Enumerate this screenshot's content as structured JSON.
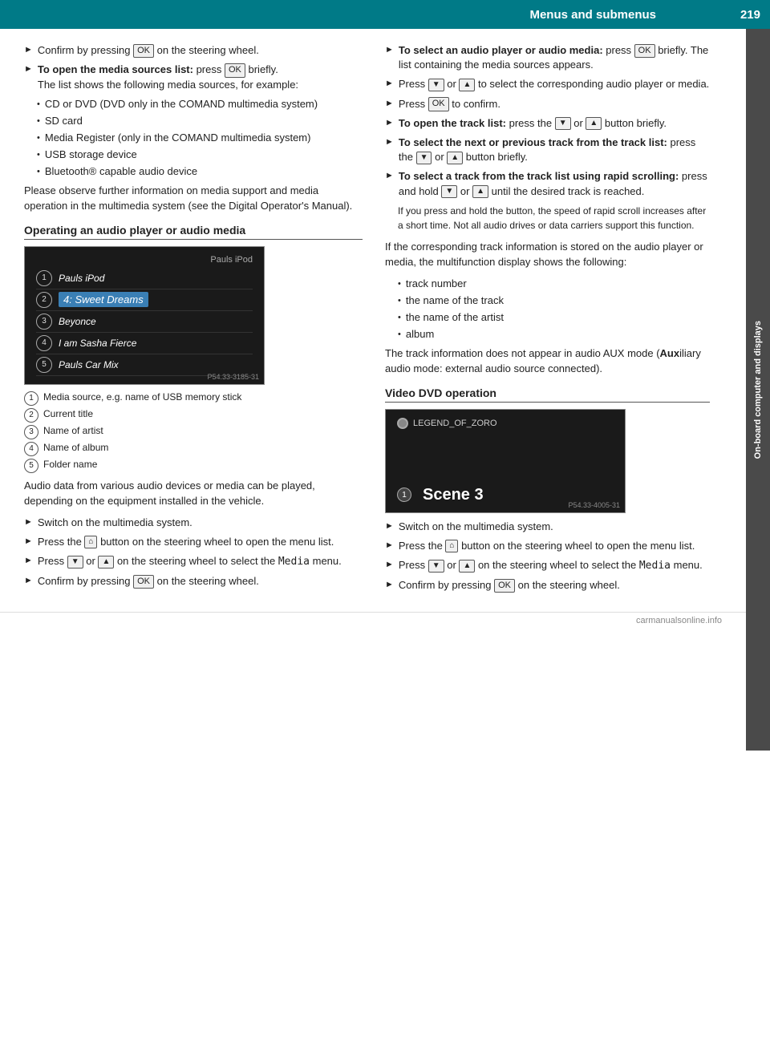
{
  "header": {
    "title": "Menus and submenus",
    "page_number": "219"
  },
  "sidebar_label": "On-board computer and displays",
  "left_col": {
    "bullet1": {
      "text_before": "Confirm by pressing ",
      "btn": "OK",
      "text_after": " on the steering wheel."
    },
    "bullet2": {
      "bold_part": "To open the media sources list:",
      "text_part": " press ",
      "btn": "OK",
      "text2": " briefly.",
      "subtext": "The list shows the following media sources, for example:"
    },
    "sub_bullets": [
      "CD or DVD (DVD only in the COMAND multimedia system)",
      "SD card",
      "Media Register (only in the COMAND multimedia system)",
      "USB storage device",
      "Bluetooth® capable audio device"
    ],
    "para1": "Please observe further information on media support and media operation in the multimedia system (see the Digital Operator's Manual).",
    "section1_title": "Operating an audio player or audio media",
    "media_image": {
      "device_name": "Pauls iPod",
      "rows": [
        {
          "num": "1",
          "name": "Pauls iPod",
          "active": false
        },
        {
          "num": "2",
          "name": "4: Sweet Dreams",
          "active": true
        },
        {
          "num": "3",
          "name": "Beyonce",
          "active": false
        },
        {
          "num": "4",
          "name": "I am Sasha Fierce",
          "active": false
        },
        {
          "num": "5",
          "name": "Pauls Car Mix",
          "active": false
        }
      ],
      "stamp": "P54.33-3185-31"
    },
    "captions": [
      {
        "num": "1",
        "text": "Media source, e.g. name of USB memory stick"
      },
      {
        "num": "2",
        "text": "Current title"
      },
      {
        "num": "3",
        "text": "Name of artist"
      },
      {
        "num": "4",
        "text": "Name of album"
      },
      {
        "num": "5",
        "text": "Folder name"
      }
    ],
    "para2": "Audio data from various audio devices or media can be played, depending on the equipment installed in the vehicle.",
    "bullet3": "Switch on the multimedia system.",
    "bullet4_before": "Press the ",
    "bullet4_btn": "⌂",
    "bullet4_after": " button on the steering wheel to open the menu list.",
    "bullet5_before": "Press ",
    "bullet5_nav1": "▼",
    "bullet5_or": " or ",
    "bullet5_nav2": "▲",
    "bullet5_after": " on the steering wheel to select the ",
    "bullet5_menu": "Media",
    "bullet5_end": " menu.",
    "bullet6_before": "Confirm by pressing ",
    "bullet6_btn": "OK",
    "bullet6_after": " on the steering wheel."
  },
  "right_col": {
    "bullet1": {
      "bold": "To select an audio player or audio media:",
      "text1": " press ",
      "btn1": "OK",
      "text2": " briefly. The list containing the media sources appears."
    },
    "bullet2_before": "Press ",
    "bullet2_nav1": "▼",
    "bullet2_or": " or ",
    "bullet2_nav2": "▲",
    "bullet2_after": " to select the corresponding audio player or media.",
    "bullet3_before": "Press ",
    "bullet3_btn": "OK",
    "bullet3_after": " to confirm.",
    "bullet4": {
      "bold": "To open the track list:",
      "text": " press the ",
      "nav1": "▼",
      "or": " or ",
      "nav2": "▲",
      "end": " button briefly."
    },
    "bullet5": {
      "bold": "To select the next or previous track from the track list:",
      "text": " press the ",
      "nav1": "▼",
      "or": " or ",
      "nav2": "▲",
      "end": " button briefly."
    },
    "bullet6": {
      "bold": "To select a track from the track list using rapid scrolling:",
      "text": " press and hold ",
      "nav1": "▼",
      "or": " or ",
      "nav2": "▲",
      "end": " until the desired track is reached."
    },
    "rapid_scroll_note": "If you press and hold the button, the speed of rapid scroll increases after a short time. Not all audio drives or data carriers support this function.",
    "para_stored": "If the corresponding track information is stored on the audio player or media, the multifunction display shows the following:",
    "stored_items": [
      "track number",
      "the name of the track",
      "the name of the artist",
      "album"
    ],
    "aux_note": "The track information does not appear in audio AUX mode (",
    "aux_bold": "Aux",
    "aux_end": "iliary audio mode: external audio source connected).",
    "section2_title": "Video DVD operation",
    "video_image": {
      "disc_label": "LEGEND_OF_ZORO",
      "num": "1",
      "scene_text": "Scene 3",
      "stamp": "P54.33-4005-31"
    },
    "vbullet1": "Switch on the multimedia system.",
    "vbullet2_before": "Press the ",
    "vbullet2_btn": "⌂",
    "vbullet2_after": " button on the steering wheel to open the menu list.",
    "vbullet3_before": "Press ",
    "vbullet3_nav1": "▼",
    "vbullet3_or": " or ",
    "vbullet3_nav2": "▲",
    "vbullet3_after": " on the steering wheel to select the ",
    "vbullet3_menu": "Media",
    "vbullet3_end": " menu.",
    "vbullet4_before": "Confirm by pressing ",
    "vbullet4_btn": "OK",
    "vbullet4_after": " on the steering wheel."
  }
}
